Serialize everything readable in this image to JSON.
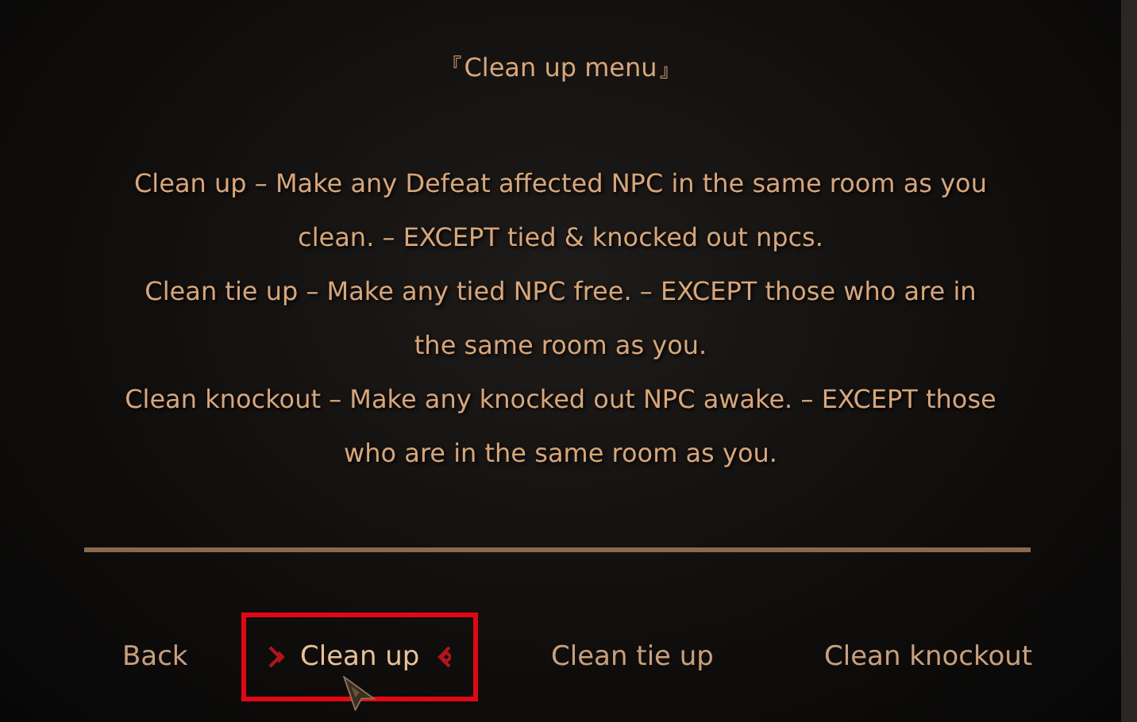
{
  "title": "『Clean up menu』",
  "paragraphs": [
    "Clean up – Make any Defeat affected NPC in the same room as you clean. – EXCEPT tied & knocked out npcs.",
    "Clean tie up – Make any tied NPC free. – EXCEPT those who are in the same room as you.",
    "Clean knockout – Make any knocked out NPC awake. – EXCEPT those who are in the same room as you."
  ],
  "buttons": [
    {
      "label": "Back",
      "selected": false
    },
    {
      "label": "Clean up",
      "selected": true
    },
    {
      "label": "Clean tie up",
      "selected": false
    },
    {
      "label": "Clean knockout",
      "selected": false
    }
  ]
}
